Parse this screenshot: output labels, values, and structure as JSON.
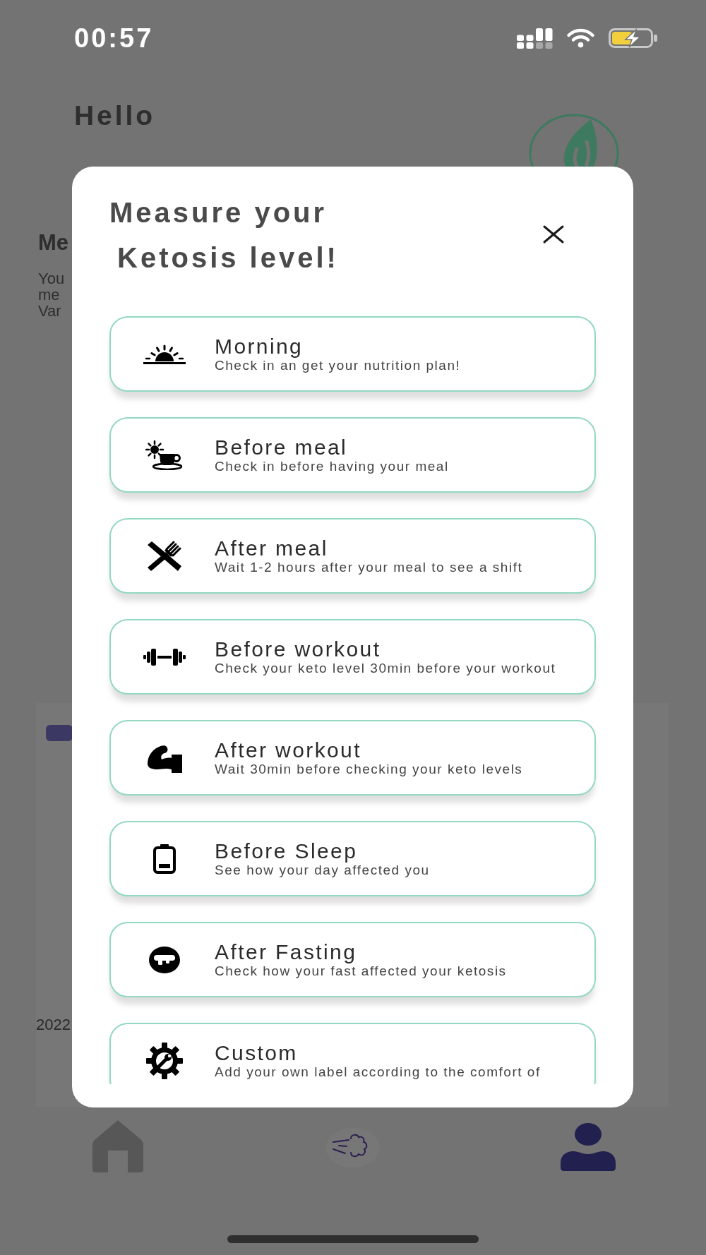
{
  "status_bar": {
    "time": "00:57"
  },
  "background": {
    "greeting": "Hello",
    "section_title": "Me",
    "section_lines": [
      "You",
      "me",
      "Var"
    ],
    "date": "2022"
  },
  "dialog": {
    "title_lines": [
      "Measure your",
      "Ketosis level!"
    ],
    "options": [
      {
        "kind": "sunrise",
        "title": "Morning",
        "description": "Check in an get your nutrition plan!"
      },
      {
        "kind": "coffee",
        "title": "Before meal",
        "description": "Check in before having your meal"
      },
      {
        "kind": "meal",
        "title": "After meal",
        "description": "Wait 1-2 hours after your meal to see a shift"
      },
      {
        "kind": "dumbbell",
        "title": "Before workout",
        "description": "Check your keto level 30min before your workout"
      },
      {
        "kind": "arm",
        "title": "After workout",
        "description": "Wait 30min before checking your keto levels"
      },
      {
        "kind": "battery",
        "title": "Before Sleep",
        "description": "See how your day affected you"
      },
      {
        "kind": "face",
        "title": "After Fasting",
        "description": "Check how your fast affected your ketosis"
      },
      {
        "kind": "gear",
        "title": "Custom",
        "description": "Add your own label according to the comfort of"
      }
    ]
  },
  "bottom_nav": [
    {
      "kind": "home",
      "selected": false
    },
    {
      "kind": "breath",
      "selected": false
    },
    {
      "kind": "profile",
      "selected": true
    }
  ]
}
